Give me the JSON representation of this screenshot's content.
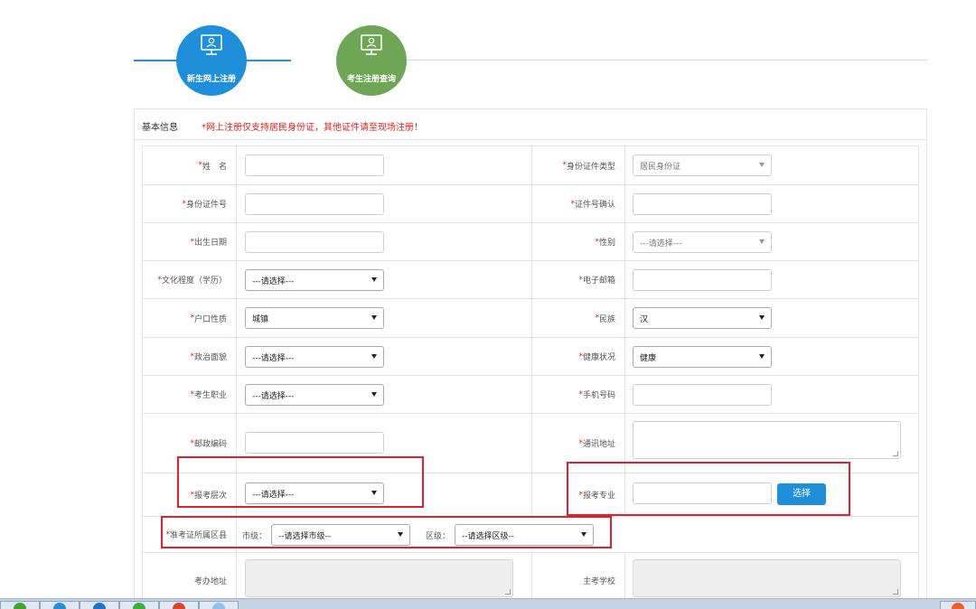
{
  "steps": [
    {
      "label": "新生网上注册",
      "color": "#1f8fdc",
      "icon": "monitor-user-icon",
      "active": true
    },
    {
      "label": "考生注册查询",
      "color": "#6fa656",
      "icon": "monitor-user-icon",
      "active": false
    }
  ],
  "panel": {
    "title": "基本信息",
    "notice": "*网上注册仅支持居民身份证，其他证件请至现场注册！"
  },
  "form": {
    "name_label": "姓　名",
    "id_type_label": "身份证件类型",
    "id_type_value": "居民身份证",
    "id_number_label": "身份证件号",
    "id_confirm_label": "证件号确认",
    "birth_label": "出生日期",
    "gender_label": "性别",
    "gender_value": "---请选择---",
    "education_label": "文化程度（学历）",
    "education_value": "---请选择---",
    "email_label": "电子邮箱",
    "hukou_label": "户口性质",
    "hukou_value": "城镇",
    "ethnic_label": "民族",
    "ethnic_value": "汉",
    "political_label": "政治面貌",
    "political_value": "---请选择---",
    "health_label": "健康状况",
    "health_value": "健康",
    "occupation_label": "考生职业",
    "occupation_value": "---请选择---",
    "phone_label": "手机号码",
    "postcode_label": "邮政编码",
    "address_label": "通讯地址",
    "level_label": "报考层次",
    "level_value": "---请选择---",
    "major_label": "报考专业",
    "choose_button": "选择",
    "district_label": "准考证所属区县",
    "city_prefix": "市级：",
    "city_value": "--请选择市级--",
    "area_prefix": "区级：",
    "area_value": "--请选择区级--",
    "office_address_label": "考办地址",
    "main_school_label": "主考学校",
    "required_mark": "*"
  },
  "colors": {
    "primary": "#1f8fdc",
    "secondary": "#6fa656",
    "required": "#e02020",
    "highlight_box": "#e0202b"
  }
}
